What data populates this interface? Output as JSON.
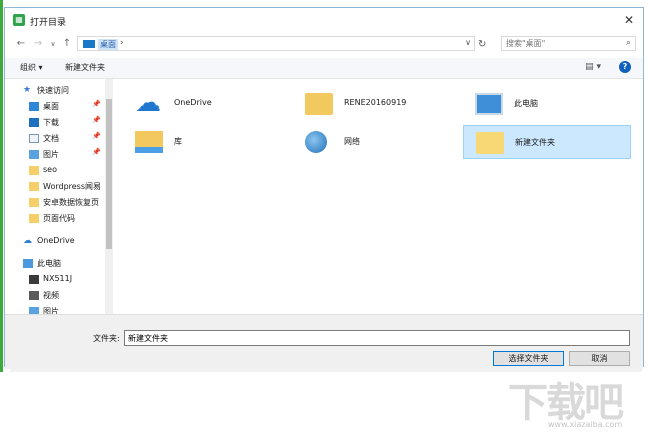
{
  "window": {
    "title": "打开目录",
    "close_glyph": "✕"
  },
  "nav": {
    "back_glyph": "←",
    "forward_glyph": "→",
    "recent_glyph": "∨",
    "up_glyph": "↑",
    "address_crumb": "桌面",
    "address_sep": "›",
    "address_dropdown": "∨",
    "refresh_glyph": "↻",
    "search_placeholder": "搜索\"桌面\"",
    "search_icon": "⌕"
  },
  "toolbar": {
    "organize": "组织 ▾",
    "new_folder": "新建文件夹",
    "view_glyph": "▤ ▾",
    "help_glyph": "?"
  },
  "sidebar": {
    "items": [
      {
        "label": "快速访问",
        "icon": "star-icon",
        "pinned": false
      },
      {
        "label": "桌面",
        "icon": "desktop-icon",
        "pinned": true
      },
      {
        "label": "下载",
        "icon": "download-icon",
        "pinned": true
      },
      {
        "label": "文档",
        "icon": "document-icon",
        "pinned": true
      },
      {
        "label": "图片",
        "icon": "pictures-icon",
        "pinned": true
      },
      {
        "label": "seo",
        "icon": "folder-icon",
        "pinned": false
      },
      {
        "label": "Wordpress闻易",
        "icon": "folder-icon",
        "pinned": false
      },
      {
        "label": "安卓数据恢复页",
        "icon": "folder-icon",
        "pinned": false
      },
      {
        "label": "页面代码",
        "icon": "folder-icon",
        "pinned": false
      },
      {
        "label": "OneDrive",
        "icon": "cloud-icon",
        "pinned": false
      },
      {
        "label": "此电脑",
        "icon": "computer-icon",
        "pinned": false
      },
      {
        "label": "NX511J",
        "icon": "phone-icon",
        "pinned": false
      },
      {
        "label": "视频",
        "icon": "video-icon",
        "pinned": false
      },
      {
        "label": "图片",
        "icon": "pictures-icon",
        "pinned": false
      }
    ],
    "pin_glyph": "📌"
  },
  "content": {
    "items": [
      {
        "label": "OneDrive",
        "icon": "cloud-icon",
        "selected": false
      },
      {
        "label": "RENE20160919",
        "icon": "user-folder-icon",
        "selected": false
      },
      {
        "label": "此电脑",
        "icon": "computer-icon",
        "selected": false
      },
      {
        "label": "库",
        "icon": "library-icon",
        "selected": false
      },
      {
        "label": "网络",
        "icon": "network-icon",
        "selected": false
      },
      {
        "label": "新建文件夹",
        "icon": "folder-icon",
        "selected": true
      }
    ]
  },
  "footer": {
    "filename_label": "文件夹:",
    "filename_value": "新建文件夹",
    "select_button": "选择文件夹",
    "cancel_button": "取消"
  },
  "colors": {
    "accent": "#0078d7",
    "selection": "#cce8ff",
    "folder": "#f8d775",
    "app_green": "#2fa34a"
  },
  "watermark": {
    "brand": "下载吧",
    "url": "www.xiazaiba.com"
  }
}
